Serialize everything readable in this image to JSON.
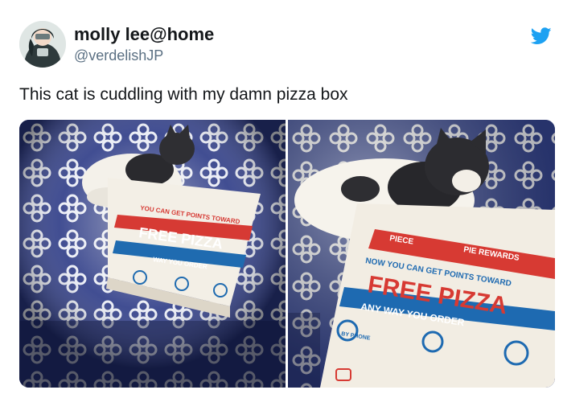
{
  "author": {
    "display_name": "molly lee@home",
    "handle": "@verdelishJP"
  },
  "tweet": {
    "text": "This cat is cuddling with my damn pizza box"
  },
  "icons": {
    "brand": "twitter-bird-icon"
  },
  "colors": {
    "twitter_blue": "#1da1f2",
    "handle_gray": "#5b7083",
    "text": "#14171a"
  },
  "media": {
    "left_box_print": {
      "line1": "YOU CAN GET POINTS TOWARD",
      "line2": "FREE PIZZA",
      "line3": "WAY YOU ORDER"
    },
    "right_box_print": {
      "line1": "PIECE",
      "line2": "PIE REWARDS",
      "line3": "NOW YOU CAN GET POINTS TOWARD",
      "line4": "FREE PIZZA",
      "line5": "ANY WAY YOU ORDER",
      "line6": "BY PHONE"
    }
  }
}
